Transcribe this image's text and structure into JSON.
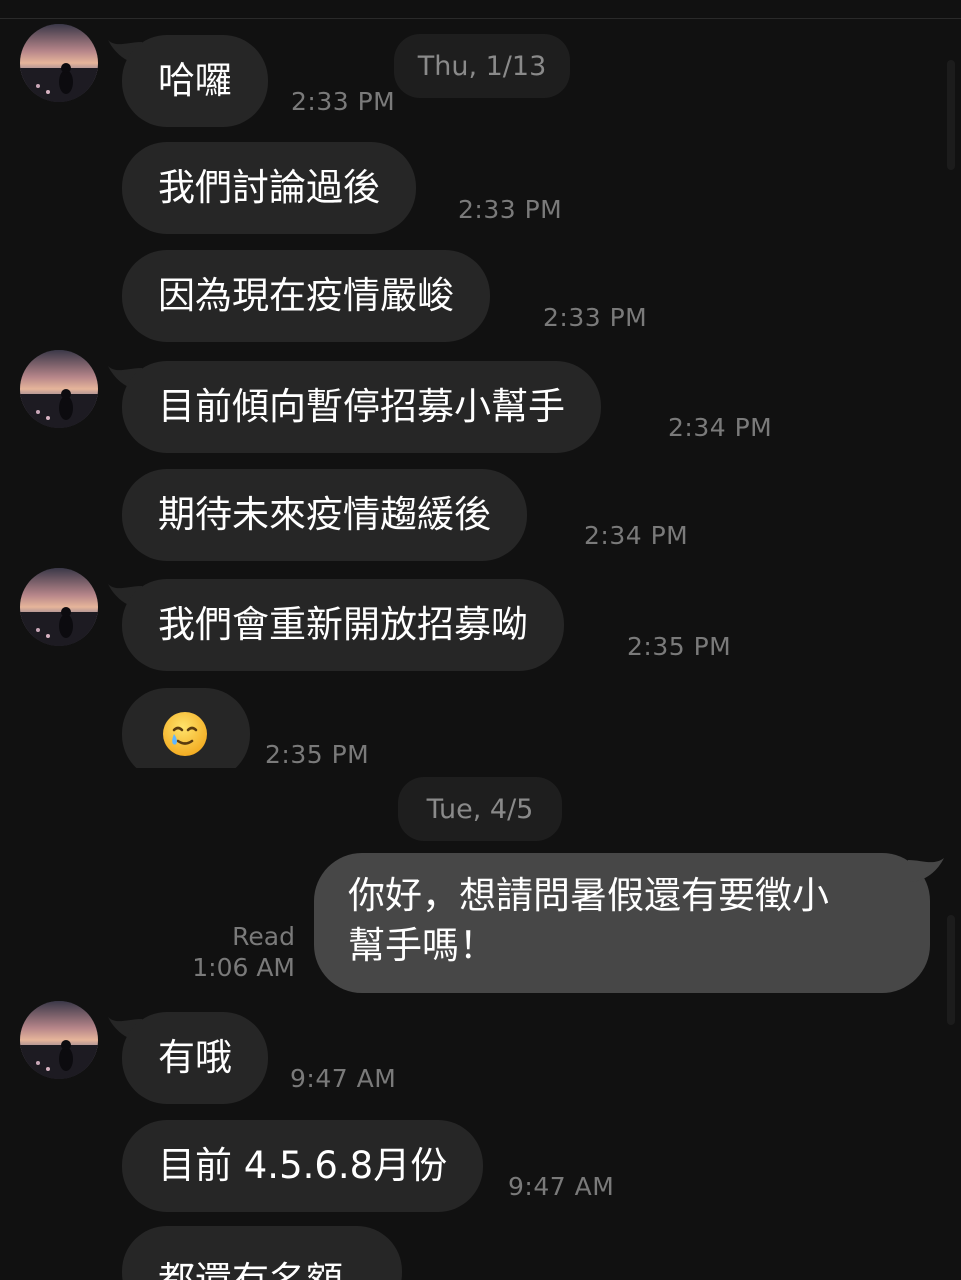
{
  "conversation": {
    "date_thu": "Thu, 1/13",
    "date_tue": "Tue, 4/5",
    "messages_in": [
      {
        "text": "哈囉",
        "time": "2:33 PM"
      },
      {
        "text": "我們討論過後",
        "time": "2:33 PM"
      },
      {
        "text": "因為現在疫情嚴峻",
        "time": "2:33 PM"
      },
      {
        "text": "目前傾向暫停招募小幫手",
        "time": "2:34 PM"
      },
      {
        "text": "期待未來疫情趨緩後",
        "time": "2:34 PM"
      },
      {
        "text": "我們會重新開放招募呦",
        "time": "2:35 PM"
      },
      {
        "text": "🥲",
        "time": "2:35 PM"
      },
      {
        "text": "有哦",
        "time": "9:47 AM"
      },
      {
        "text": "目前 4.5.6.8月份",
        "time": "9:47 AM"
      },
      {
        "text": "都還有名額",
        "time": ""
      }
    ],
    "message_out": {
      "line1": "你好，想請問暑假還有要徵小",
      "line2": "幫手嗎！",
      "status": "Read",
      "time": "1:06 AM"
    }
  },
  "icons": {
    "avatar": "sunset-profile-avatar",
    "emoji": "smiling-face-with-tear-icon"
  },
  "colors": {
    "background": "#111111",
    "incoming_bubble": "#262626",
    "outgoing_bubble": "#474747",
    "timestamp": "#7a7a7a"
  }
}
